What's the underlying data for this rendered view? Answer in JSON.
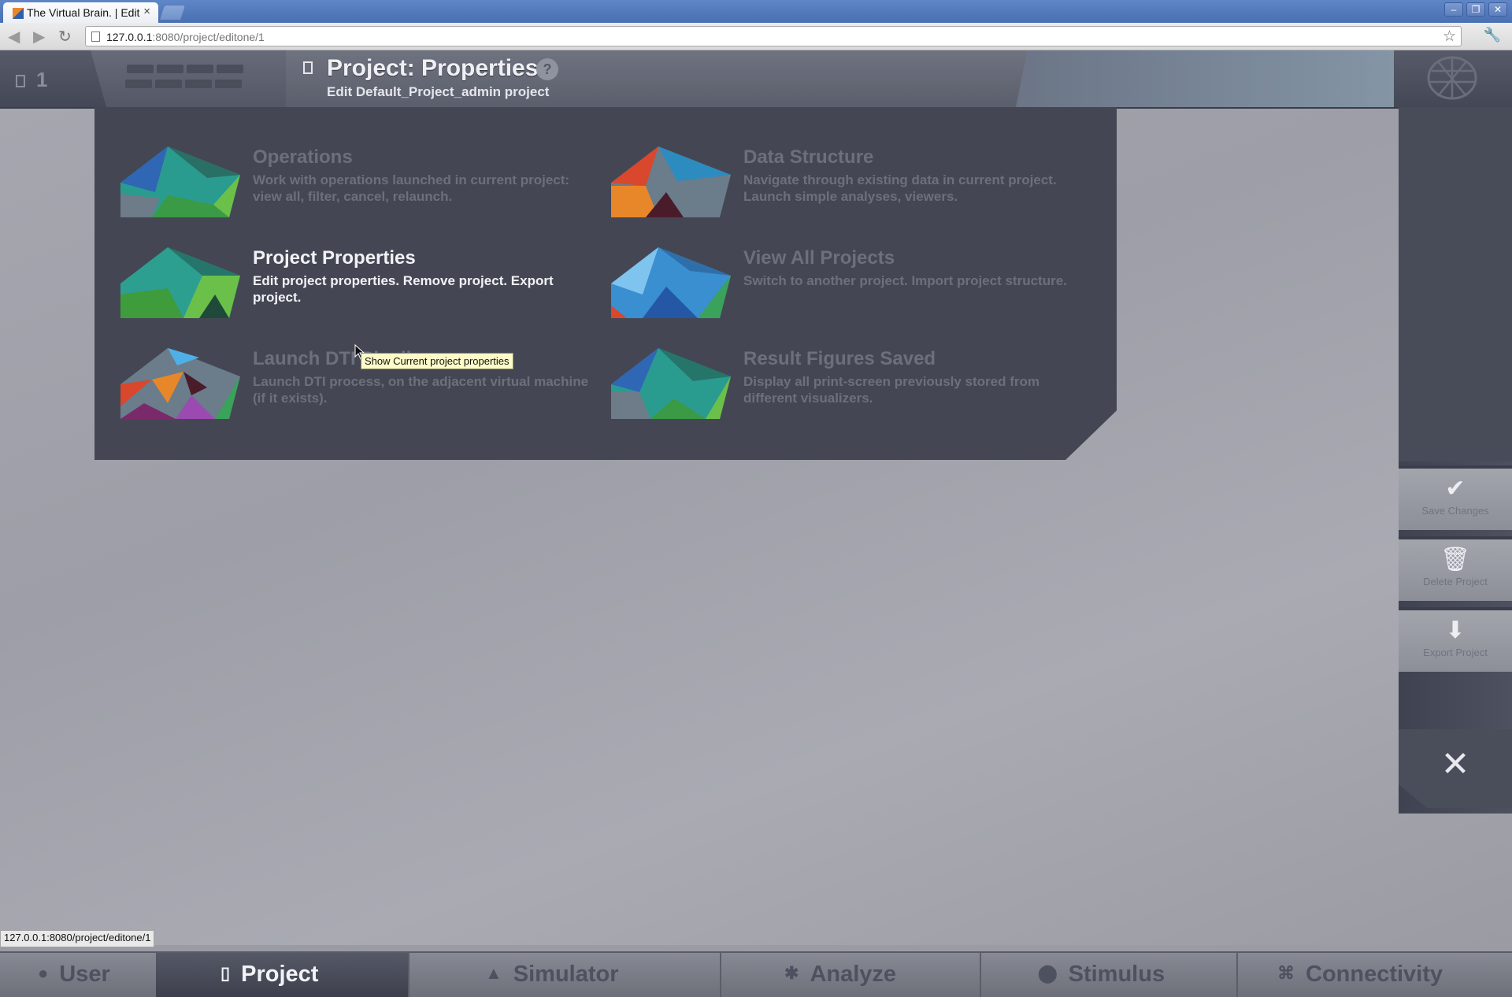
{
  "browser": {
    "tab_title": "The Virtual Brain. | Edit",
    "tab_close": "×",
    "address_host": "127.0.0.1",
    "address_rest": ":8080/project/editone/1",
    "status_url": "127.0.0.1:8080/project/editone/1",
    "window_buttons": [
      "–",
      "❐",
      "✕"
    ]
  },
  "header": {
    "project_count": "1",
    "page_title": "Project: Properties",
    "help": "?",
    "subtitle": "Edit Default_Project_admin project"
  },
  "menu": [
    {
      "title": "Operations",
      "desc": "Work with operations launched in current project: view all, filter, cancel, relaunch.",
      "active": false
    },
    {
      "title": "Data Structure",
      "desc": "Navigate through existing data in current project. Launch simple analyses, viewers.",
      "active": false
    },
    {
      "title": "Project Properties",
      "desc": "Edit project properties. Remove project. Export project.",
      "active": true
    },
    {
      "title": "View All Projects",
      "desc": "Switch to another project. Import project structure.",
      "active": false
    },
    {
      "title": "Launch DTI Pipeline",
      "desc": "Launch DTI process, on the adjacent virtual machine (if it exists).",
      "active": false
    },
    {
      "title": "Result Figures Saved",
      "desc": "Display all print-screen previously stored from different visualizers.",
      "active": false
    }
  ],
  "tooltip": "Show Current project properties",
  "actions": {
    "save": "Save Changes",
    "delete": "Delete Project",
    "export": "Export Project",
    "close": "✕"
  },
  "bottom_nav": [
    {
      "label": "User",
      "icon": "user-icon"
    },
    {
      "label": "Project",
      "icon": "document-icon"
    },
    {
      "label": "Simulator",
      "icon": "rocket-icon"
    },
    {
      "label": "Analyze",
      "icon": "gear-icon"
    },
    {
      "label": "Stimulus",
      "icon": "pin-icon"
    },
    {
      "label": "Connectivity",
      "icon": "connectivity-icon"
    }
  ],
  "colors": {
    "panel": "#444753",
    "header": "#4d5160",
    "active_text": "#f1f2f6",
    "muted_text": "#6c707c",
    "tooltip_bg": "#fdfbc8"
  }
}
